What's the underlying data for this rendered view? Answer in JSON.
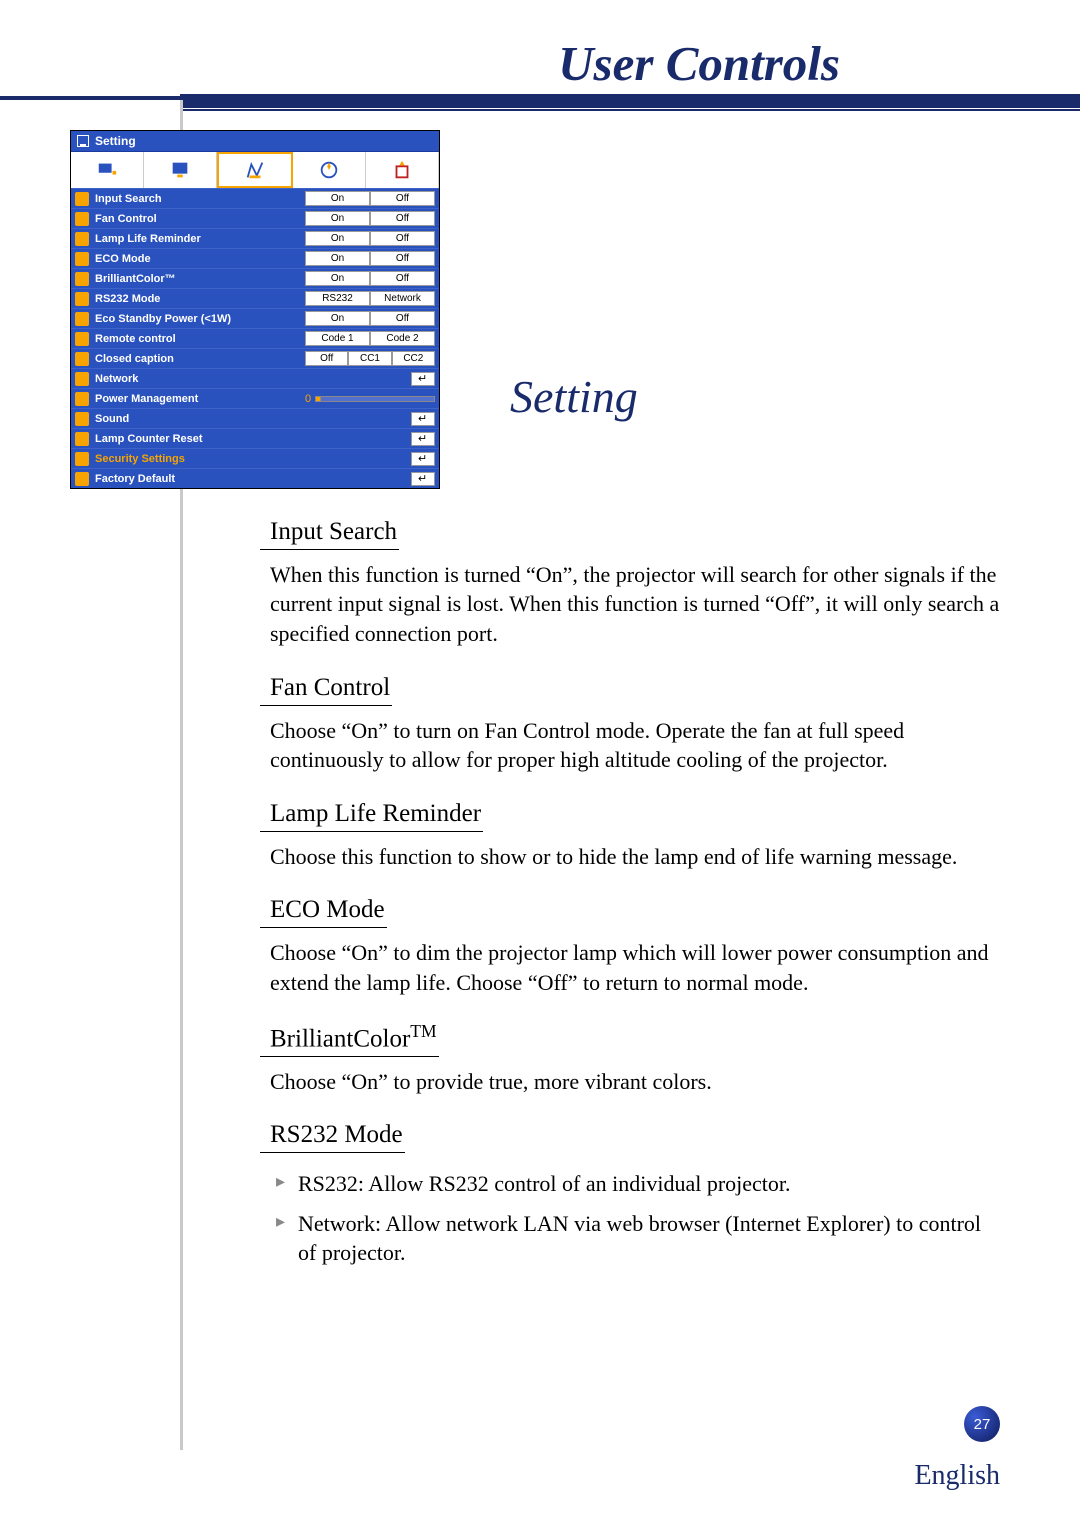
{
  "header": {
    "title": "User Controls"
  },
  "section_title": "Setting",
  "osd": {
    "title": "Setting",
    "tabs": [
      "image",
      "display",
      "setting",
      "options",
      "lamp"
    ],
    "selected_tab": 2,
    "rows": [
      {
        "label": "Input Search",
        "options": [
          "On",
          "Off"
        ]
      },
      {
        "label": "Fan Control",
        "options": [
          "On",
          "Off"
        ]
      },
      {
        "label": "Lamp Life Reminder",
        "options": [
          "On",
          "Off"
        ]
      },
      {
        "label": "ECO Mode",
        "options": [
          "On",
          "Off"
        ]
      },
      {
        "label": "BrilliantColor™",
        "options": [
          "On",
          "Off"
        ]
      },
      {
        "label": "RS232 Mode",
        "options": [
          "RS232",
          "Network"
        ]
      },
      {
        "label": "Eco Standby Power (<1W)",
        "options": [
          "On",
          "Off"
        ]
      },
      {
        "label": "Remote control",
        "options": [
          "Code 1",
          "Code 2"
        ]
      },
      {
        "label": "Closed caption",
        "options": [
          "Off",
          "CC1",
          "CC2"
        ]
      },
      {
        "label": "Network",
        "enter": true
      },
      {
        "label": "Power Management",
        "slider_value": "0"
      },
      {
        "label": "Sound",
        "enter": true
      },
      {
        "label": "Lamp Counter Reset",
        "enter": true
      },
      {
        "label": "Security Settings",
        "enter": true,
        "highlight": true
      },
      {
        "label": "Factory Default",
        "enter": true
      }
    ]
  },
  "sections": {
    "input_search": {
      "heading": "Input Search",
      "text": "When this function is turned “On”, the projector will search for other signals if the current input signal is lost. When this function is turned “Off”, it will only search a specified connection port."
    },
    "fan_control": {
      "heading": "Fan Control",
      "text": "Choose “On” to turn on Fan Control mode. Operate the fan at full speed continuously to allow for proper high altitude cooling of the projector."
    },
    "lamp_life": {
      "heading": "Lamp Life Reminder",
      "text": "Choose this function to show or to hide the lamp end of life warning message."
    },
    "eco_mode": {
      "heading": "ECO Mode",
      "text": "Choose “On” to dim the projector lamp which will lower power consumption and extend the lamp life. Choose “Off” to return to normal mode."
    },
    "brilliant": {
      "heading": "BrilliantColor",
      "text": "Choose “On” to provide true, more vibrant colors."
    },
    "rs232": {
      "heading": "RS232 Mode",
      "bullets": [
        "RS232: Allow RS232 control of an individual projector.",
        "Network: Allow network LAN via web browser (Internet Explorer) to control of projector."
      ]
    }
  },
  "page_number": "27",
  "language": "English"
}
